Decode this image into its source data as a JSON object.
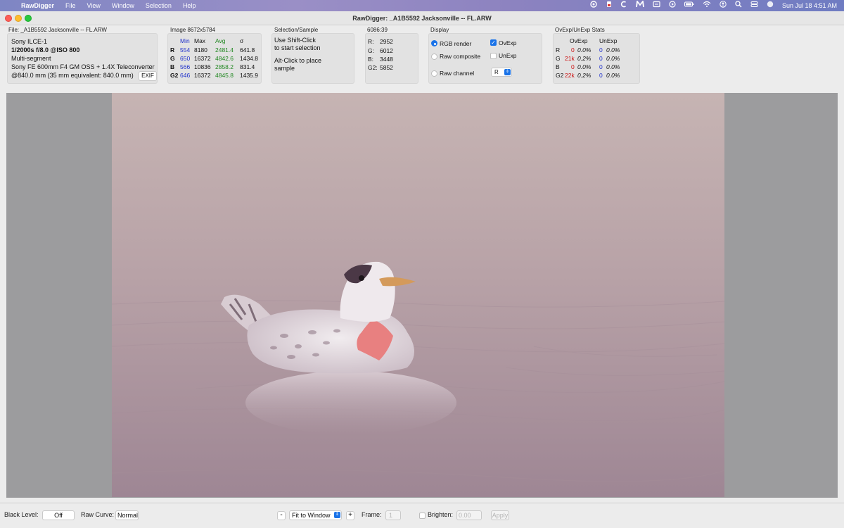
{
  "menubar": {
    "app_name": "RawDigger",
    "items": [
      "File",
      "View",
      "Window",
      "Selection",
      "Help"
    ],
    "datetime": "Sun Jul 18  4:51 AM"
  },
  "window": {
    "title": "RawDigger: _A1B5592  Jacksonville -- FL.ARW"
  },
  "file_panel": {
    "title": "File: _A1B5592  Jacksonville -- FL.ARW",
    "camera": "Sony ILCE-1",
    "exposure": "1/2000s f/8.0 @ISO 800",
    "metering": "Multi-segment",
    "lens": "Sony FE 600mm F4 GM OSS + 1.4X Teleconverter",
    "focal": "@840.0 mm (35 mm equivalent: 840.0 mm)",
    "exif_button": "EXIF"
  },
  "stats_panel": {
    "title": "Image 8672x5784",
    "headers": {
      "min": "Min",
      "max": "Max",
      "avg": "Avg",
      "sigma": "σ"
    },
    "rows": [
      {
        "ch": "R",
        "min": "554",
        "max": "8180",
        "avg": "2481.4",
        "sigma": "641.8"
      },
      {
        "ch": "G",
        "min": "650",
        "max": "16372",
        "avg": "4842.6",
        "sigma": "1434.8"
      },
      {
        "ch": "B",
        "min": "566",
        "max": "10836",
        "avg": "2858.2",
        "sigma": "831.4"
      },
      {
        "ch": "G2",
        "min": "646",
        "max": "16372",
        "avg": "4845.8",
        "sigma": "1435.9"
      }
    ]
  },
  "selection_panel": {
    "title": "Selection/Sample",
    "line1": "Use Shift-Click",
    "line2": "to start selection",
    "line3": "Alt-Click to place",
    "line4": "sample"
  },
  "coords_panel": {
    "title": "6086:39",
    "rows": [
      {
        "ch": "R:",
        "val": "2952"
      },
      {
        "ch": "G:",
        "val": "6012"
      },
      {
        "ch": "B:",
        "val": "3448"
      },
      {
        "ch": "G2:",
        "val": "5852"
      }
    ]
  },
  "display_panel": {
    "title": "Display",
    "rgb_render": "RGB render",
    "raw_composite": "Raw composite",
    "raw_channel": "Raw channel",
    "ovexp": "OvExp",
    "unexp": "UnExp",
    "channel_value": "R",
    "selected_mode": "rgb_render",
    "ovexp_checked": true,
    "unexp_checked": false
  },
  "ovexp_panel": {
    "title": "OvExp/UnExp Stats",
    "headers": {
      "ovexp": "OvExp",
      "unexp": "UnExp"
    },
    "rows": [
      {
        "ch": "R",
        "ov_count": "0",
        "ov_pct": "0.0%",
        "un_count": "0",
        "un_pct": "0.0%"
      },
      {
        "ch": "G",
        "ov_count": "21k",
        "ov_pct": "0.2%",
        "un_count": "0",
        "un_pct": "0.0%"
      },
      {
        "ch": "B",
        "ov_count": "0",
        "ov_pct": "0.0%",
        "un_count": "0",
        "un_pct": "0.0%"
      },
      {
        "ch": "G2",
        "ov_count": "22k",
        "ov_pct": "0.2%",
        "un_count": "0",
        "un_pct": "0.0%"
      }
    ]
  },
  "bottombar": {
    "black_level_label": "Black Level:",
    "black_level_value": "Off",
    "raw_curve_label": "Raw Curve:",
    "raw_curve_value": "Normal",
    "zoom_minus": "-",
    "zoom_value": "Fit to Window",
    "zoom_plus": "+",
    "frame_label": "Frame:",
    "frame_value": "1",
    "brighten_label": "Brighten:",
    "brighten_value": "0.00",
    "apply_label": "Apply"
  },
  "colors": {
    "overexposure_highlight": "#e88080",
    "accent": "#1a73e8"
  }
}
